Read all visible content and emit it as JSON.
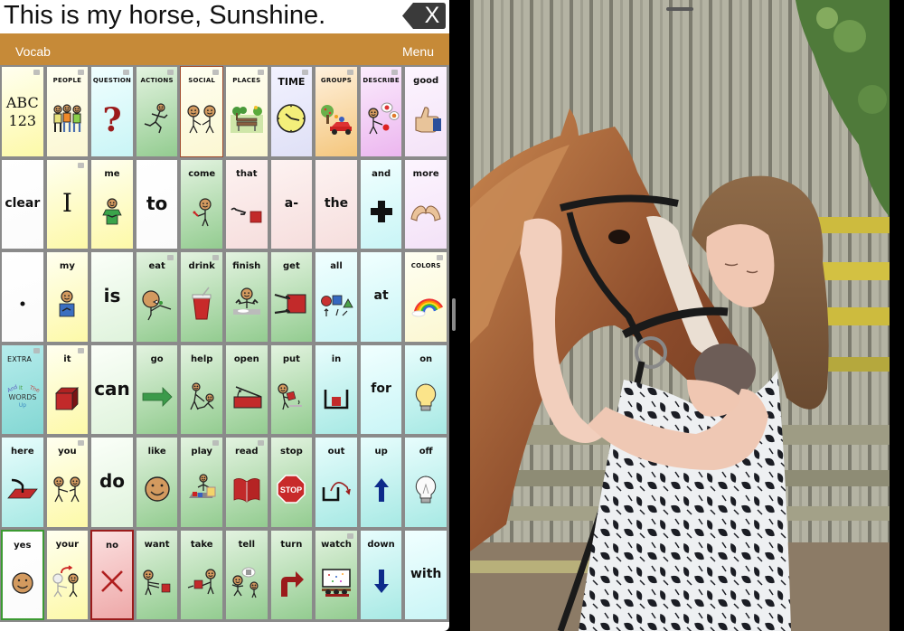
{
  "app": {
    "message_text": "This is my horse, Sunshine.",
    "clear_button_label": "X",
    "nav": {
      "vocab_label": "Vocab",
      "menu_label": "Menu"
    },
    "colors": {
      "nav_bar": "#c68a38",
      "clear_button": "#3a3a3a",
      "yes_border": "#3c9a32",
      "no_border": "#9b1b1b"
    }
  },
  "grid": {
    "rows": 6,
    "columns": 10,
    "cells": [
      {
        "label": "",
        "style": "big",
        "color": "yellow",
        "icon": "abc-123-icon",
        "folder": true,
        "text_icon": "ABC 123"
      },
      {
        "label": "PEOPLE",
        "style": "cat",
        "color": "cream",
        "icon": "people-icon",
        "folder": true
      },
      {
        "label": "QUESTION",
        "style": "cat",
        "color": "lcyan",
        "icon": "question-mark-icon",
        "folder": true
      },
      {
        "label": "ACTIONS",
        "style": "cat",
        "color": "green",
        "icon": "running-person-icon",
        "folder": true
      },
      {
        "label": "SOCIAL",
        "style": "cat",
        "color": "cream",
        "icon": "handshake-icon",
        "folder": true,
        "border": "brown"
      },
      {
        "label": "PLACES",
        "style": "cat",
        "color": "cream",
        "icon": "park-bench-icon",
        "folder": true
      },
      {
        "label": "TIME",
        "style": "time",
        "color": "lav",
        "icon": "clock-icon",
        "folder": true
      },
      {
        "label": "GROUPS",
        "style": "cat",
        "color": "orange",
        "icon": "toy-car-tree-icon",
        "folder": true
      },
      {
        "label": "DESCRIBE",
        "style": "cat",
        "color": "violet",
        "icon": "describe-person-icon",
        "folder": true
      },
      {
        "label": "good",
        "style": "word",
        "color": "lilac",
        "icon": "thumbs-up-icon"
      },
      {
        "label": "clear",
        "style": "mid",
        "color": "white"
      },
      {
        "label": "I",
        "style": "bigserif",
        "color": "yellow",
        "folder": true
      },
      {
        "label": "me",
        "style": "word",
        "color": "yellow",
        "icon": "me-person-icon"
      },
      {
        "label": "to",
        "style": "big",
        "color": "white"
      },
      {
        "label": "come",
        "style": "word",
        "color": "green",
        "icon": "come-person-icon"
      },
      {
        "label": "that",
        "style": "word",
        "color": "pink",
        "icon": "point-at-square-icon"
      },
      {
        "label": "a-",
        "style": "mid",
        "color": "pink"
      },
      {
        "label": "the",
        "style": "mid",
        "color": "pink"
      },
      {
        "label": "and",
        "style": "word",
        "color": "lcyan",
        "icon": "plus-icon"
      },
      {
        "label": "more",
        "style": "word",
        "color": "lilac",
        "icon": "hands-more-icon"
      },
      {
        "label": "",
        "style": "dot",
        "color": "white",
        "icon": "period-icon",
        "text_icon": "•"
      },
      {
        "label": "my",
        "style": "word",
        "color": "yellow",
        "icon": "my-person-icon"
      },
      {
        "label": "is",
        "style": "big",
        "color": "lgreen"
      },
      {
        "label": "eat",
        "style": "word",
        "color": "green",
        "icon": "eating-person-icon",
        "folder": true
      },
      {
        "label": "drink",
        "style": "word",
        "color": "green",
        "icon": "cup-icon",
        "folder": true
      },
      {
        "label": "finish",
        "style": "word",
        "color": "green",
        "icon": "finish-person-icon"
      },
      {
        "label": "get",
        "style": "word",
        "color": "green",
        "icon": "grab-square-icon"
      },
      {
        "label": "all",
        "style": "word",
        "color": "lcyan",
        "icon": "shapes-icon"
      },
      {
        "label": "at",
        "style": "mid",
        "color": "lcyan"
      },
      {
        "label": "COLORS",
        "style": "cat",
        "color": "cream",
        "icon": "rainbow-icon",
        "folder": true
      },
      {
        "label": "EXTRA",
        "style": "catleft",
        "color": "teal",
        "icon": "extra-words-icon",
        "folder": true
      },
      {
        "label": "it",
        "style": "word",
        "color": "yellow",
        "icon": "red-cube-icon",
        "folder": true
      },
      {
        "label": "can",
        "style": "big",
        "color": "lgreen"
      },
      {
        "label": "go",
        "style": "word",
        "color": "green",
        "icon": "green-arrow-icon"
      },
      {
        "label": "help",
        "style": "word",
        "color": "green",
        "icon": "help-people-icon"
      },
      {
        "label": "open",
        "style": "word",
        "color": "green",
        "icon": "open-box-icon"
      },
      {
        "label": "put",
        "style": "word",
        "color": "green",
        "icon": "put-person-icon"
      },
      {
        "label": "in",
        "style": "word",
        "color": "cyan",
        "icon": "in-container-icon"
      },
      {
        "label": "for",
        "style": "mid",
        "color": "lcyan"
      },
      {
        "label": "on",
        "style": "word",
        "color": "cyan",
        "icon": "light-bulb-on-icon"
      },
      {
        "label": "here",
        "style": "word",
        "color": "cyan",
        "icon": "point-here-icon"
      },
      {
        "label": "you",
        "style": "word",
        "color": "yellow",
        "icon": "you-people-icon",
        "folder": true
      },
      {
        "label": "do",
        "style": "big",
        "color": "lgreen"
      },
      {
        "label": "like",
        "style": "word",
        "color": "green",
        "icon": "smiley-face-icon"
      },
      {
        "label": "play",
        "style": "word",
        "color": "green",
        "icon": "play-person-icon",
        "folder": true
      },
      {
        "label": "read",
        "style": "word",
        "color": "green",
        "icon": "book-icon",
        "folder": true
      },
      {
        "label": "stop",
        "style": "word",
        "color": "green",
        "icon": "stop-sign-icon"
      },
      {
        "label": "out",
        "style": "word",
        "color": "cyan",
        "icon": "out-container-icon"
      },
      {
        "label": "up",
        "style": "word",
        "color": "cyan",
        "icon": "arrow-up-icon"
      },
      {
        "label": "off",
        "style": "word",
        "color": "cyan",
        "icon": "light-bulb-off-icon"
      },
      {
        "label": "yes",
        "style": "word",
        "color": "white",
        "icon": "yes-face-icon",
        "border": "green"
      },
      {
        "label": "your",
        "style": "word",
        "color": "yellow",
        "icon": "your-people-icon"
      },
      {
        "label": "no",
        "style": "word",
        "color": "red",
        "icon": "x-mark-icon"
      },
      {
        "label": "want",
        "style": "word",
        "color": "green",
        "icon": "want-person-icon"
      },
      {
        "label": "take",
        "style": "word",
        "color": "green",
        "icon": "take-person-icon"
      },
      {
        "label": "tell",
        "style": "word",
        "color": "green",
        "icon": "tell-people-icon"
      },
      {
        "label": "turn",
        "style": "word",
        "color": "green",
        "icon": "turn-arrow-icon"
      },
      {
        "label": "watch",
        "style": "word",
        "color": "green",
        "icon": "watch-screen-icon",
        "folder": true
      },
      {
        "label": "down",
        "style": "word",
        "color": "cyan",
        "icon": "arrow-down-icon"
      },
      {
        "label": "with",
        "style": "mid",
        "color": "lcyan"
      }
    ]
  },
  "extra_words_icon_text": [
    "And",
    "It",
    "The",
    "WORDS",
    "Up"
  ],
  "abc_icon_text": [
    "ABC",
    "123"
  ],
  "stop_sign_text": "STOP",
  "photo": {
    "description": "Girl in a white floral dress hugging a chestnut horse with a white blaze and black bridle, in front of a wooden fence"
  }
}
